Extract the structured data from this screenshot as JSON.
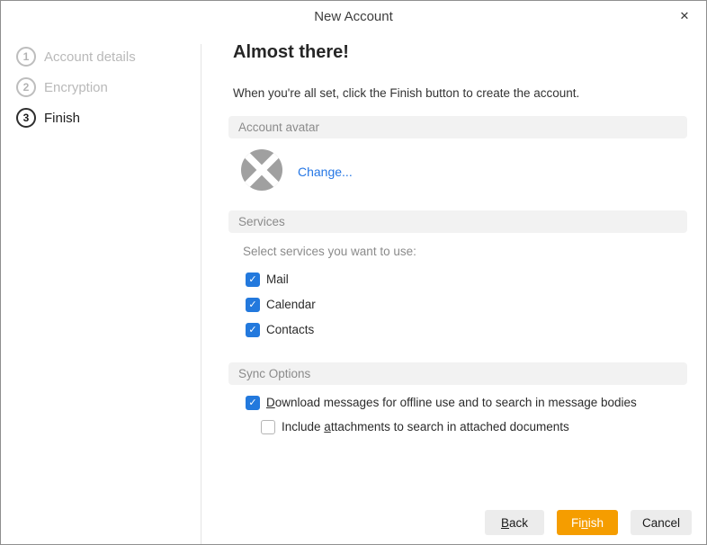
{
  "window": {
    "title": "New Account"
  },
  "icons": {
    "close": "✕",
    "check": "✓"
  },
  "colors": {
    "accent_orange": "#F59D00",
    "checkbox_blue": "#2379DD",
    "link_blue": "#2577E5",
    "section_bar_bg": "#F2F2F2"
  },
  "wizard": {
    "steps": [
      {
        "number": "1",
        "label": "Account details",
        "active": false
      },
      {
        "number": "2",
        "label": "Encryption",
        "active": false
      },
      {
        "number": "3",
        "label": "Finish",
        "active": true
      }
    ]
  },
  "main": {
    "heading": "Almost there!",
    "subtitle": "When you're all set, click the Finish button to create the account.",
    "avatar_section": {
      "header": "Account avatar",
      "change_link": "Change..."
    },
    "services_section": {
      "header": "Services",
      "hint": "Select services you want to use:",
      "services": [
        {
          "label": "Mail",
          "checked": true
        },
        {
          "label": "Calendar",
          "checked": true
        },
        {
          "label": "Contacts",
          "checked": true
        }
      ]
    },
    "sync_section": {
      "header": "Sync Options",
      "options": [
        {
          "pre": "",
          "mnemonic": "D",
          "post": "ownload messages for offline use and to search in message bodies",
          "checked": true
        },
        {
          "pre": "Include ",
          "mnemonic": "a",
          "post": "ttachments to search in attached documents",
          "checked": false
        }
      ]
    }
  },
  "footer": {
    "back": {
      "pre": "",
      "mnemonic": "B",
      "post": "ack"
    },
    "finish": {
      "pre": "Fi",
      "mnemonic": "n",
      "post": "ish"
    },
    "cancel": {
      "pre": "Cancel",
      "mnemonic": "",
      "post": ""
    }
  }
}
